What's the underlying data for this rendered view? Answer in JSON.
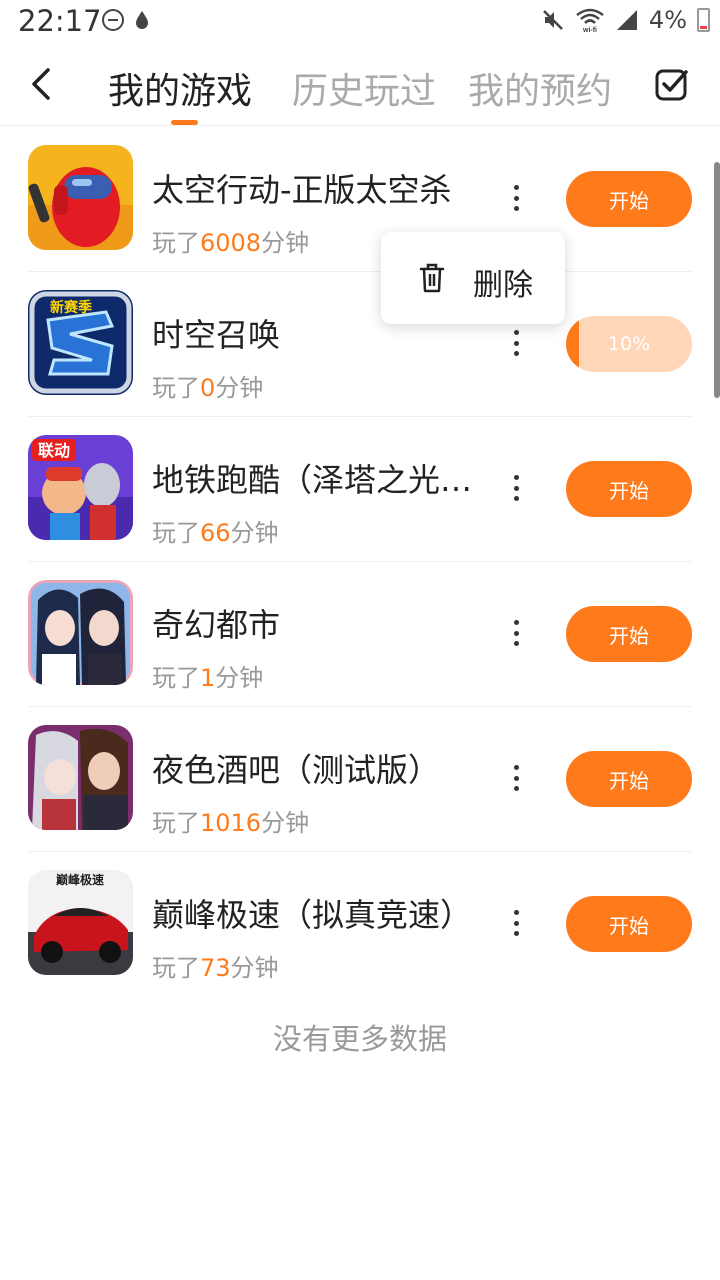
{
  "status_bar": {
    "time": "22:17",
    "battery": "4%",
    "icons": [
      "dnd-icon",
      "drop-icon",
      "mute-icon",
      "wifi-icon",
      "signal-icon",
      "battery-icon"
    ]
  },
  "tabs": [
    {
      "label": "我的游戏",
      "active": true
    },
    {
      "label": "历史玩过",
      "active": false
    },
    {
      "label": "我的预约",
      "active": false
    }
  ],
  "accent_color": "#ff7a1a",
  "games": [
    {
      "name": "太空行动-正版太空杀",
      "played_prefix": "玩了",
      "minutes": "6008",
      "played_suffix": "分钟",
      "action": "开始"
    },
    {
      "name": "时空召唤",
      "played_prefix": "玩了",
      "minutes": "0",
      "played_suffix": "分钟",
      "action": "10%",
      "progress": 0.1
    },
    {
      "name": "地铁跑酷（泽塔之光…",
      "played_prefix": "玩了",
      "minutes": "66",
      "played_suffix": "分钟",
      "action": "开始"
    },
    {
      "name": "奇幻都市",
      "played_prefix": "玩了",
      "minutes": "1",
      "played_suffix": "分钟",
      "action": "开始"
    },
    {
      "name": "夜色酒吧（测试版）",
      "played_prefix": "玩了",
      "minutes": "1016",
      "played_suffix": "分钟",
      "action": "开始"
    },
    {
      "name": "巅峰极速（拟真竞速）",
      "played_prefix": "玩了",
      "minutes": "73",
      "played_suffix": "分钟",
      "action": "开始"
    }
  ],
  "icon_texts": {
    "subway_badge": "联动",
    "racing_logo": "巅峰极速",
    "shikong_badge": "新赛季"
  },
  "popup": {
    "delete_label": "删除"
  },
  "footer": {
    "no_more": "没有更多数据"
  }
}
